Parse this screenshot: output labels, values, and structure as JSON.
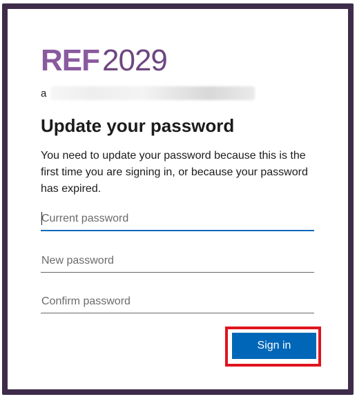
{
  "logo": {
    "brand": "REF",
    "year": "2029"
  },
  "account": {
    "prefix": "a"
  },
  "page": {
    "title": "Update your password",
    "description": "You need to update your password because this is the first time you are signing in, or because your password has expired."
  },
  "form": {
    "current_password": {
      "placeholder": "Current password",
      "value": ""
    },
    "new_password": {
      "placeholder": "New password",
      "value": ""
    },
    "confirm_password": {
      "placeholder": "Confirm password",
      "value": ""
    },
    "submit_label": "Sign in"
  },
  "colors": {
    "brand_purple": "#8a5a9e",
    "primary_button": "#0067b8",
    "highlight_border": "#e0141e",
    "frame": "#3e2c4a"
  }
}
